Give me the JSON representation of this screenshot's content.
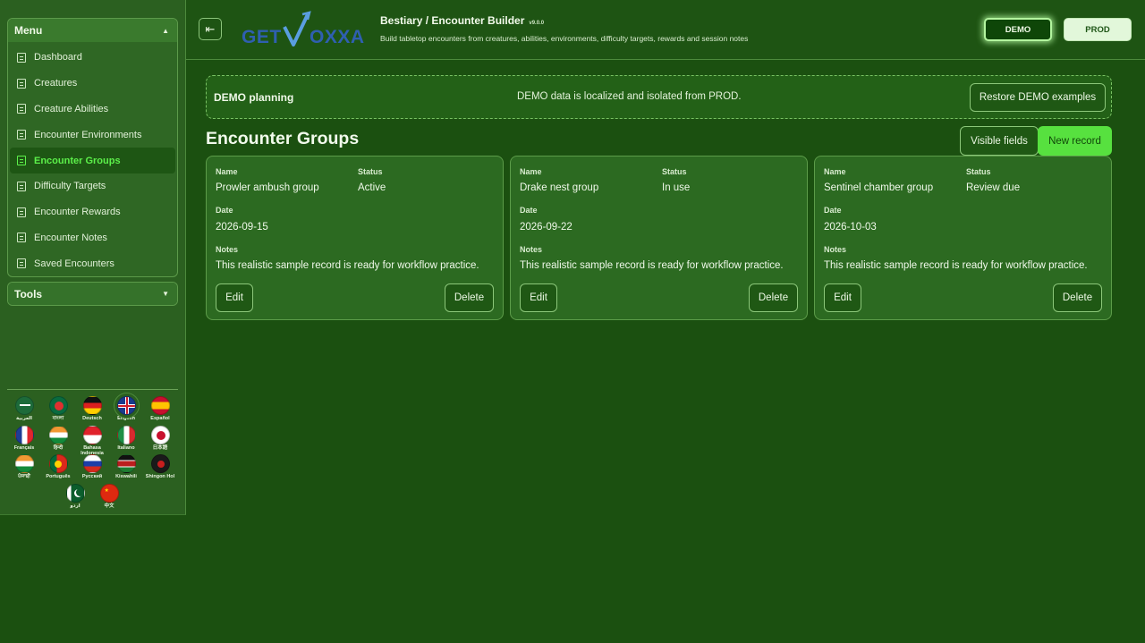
{
  "sidebar": {
    "menu_title": "Menu",
    "tools_title": "Tools",
    "items": [
      {
        "label": "Dashboard"
      },
      {
        "label": "Creatures"
      },
      {
        "label": "Creature Abilities"
      },
      {
        "label": "Encounter Environments"
      },
      {
        "label": "Encounter Groups",
        "active": true
      },
      {
        "label": "Difficulty Targets"
      },
      {
        "label": "Encounter Rewards"
      },
      {
        "label": "Encounter Notes"
      },
      {
        "label": "Saved Encounters"
      }
    ],
    "languages": [
      {
        "label": "العربية"
      },
      {
        "label": "বাংলা"
      },
      {
        "label": "Deutsch"
      },
      {
        "label": "English",
        "selected": true
      },
      {
        "label": "Español"
      },
      {
        "label": "Français"
      },
      {
        "label": "हिन्दी"
      },
      {
        "label": "Bahasa Indonesia"
      },
      {
        "label": "Italiano"
      },
      {
        "label": "日本語"
      },
      {
        "label": "ਪੰਜਾਬੀ"
      },
      {
        "label": "Português"
      },
      {
        "label": "Русский"
      },
      {
        "label": "Kiswahili"
      },
      {
        "label": "Shingon Hol"
      },
      {
        "label": "اردو"
      },
      {
        "label": "中文"
      }
    ]
  },
  "header": {
    "logo_text": "GETVOXXA",
    "title": "Bestiary / Encounter Builder",
    "version": "v9.0.0",
    "subtitle": "Build tabletop encounters from creatures, abilities, environments, difficulty targets, rewards and session notes",
    "demo_label": "DEMO",
    "prod_label": "PROD"
  },
  "banner": {
    "title": "DEMO planning",
    "message": "DEMO data is localized and isolated from PROD.",
    "restore_label": "Restore DEMO examples"
  },
  "main": {
    "section_title": "Encounter Groups",
    "visible_fields_label": "Visible fields",
    "new_record_label": "New record",
    "field_labels": {
      "name": "Name",
      "status": "Status",
      "date": "Date",
      "notes": "Notes"
    },
    "edit_label": "Edit",
    "delete_label": "Delete",
    "records": [
      {
        "name": "Prowler ambush group",
        "status": "Active",
        "date": "2026-09-15",
        "notes": "This realistic sample record is ready for workflow practice."
      },
      {
        "name": "Drake nest group",
        "status": "In use",
        "date": "2026-09-22",
        "notes": "This realistic sample record is ready for workflow practice."
      },
      {
        "name": "Sentinel chamber group",
        "status": "Review due",
        "date": "2026-10-03",
        "notes": "This realistic sample record is ready for workflow practice."
      }
    ]
  },
  "colors": {
    "page_bg": "#1b5010",
    "accent_green": "#57e13f",
    "active_menu_text": "#5cf04a"
  }
}
